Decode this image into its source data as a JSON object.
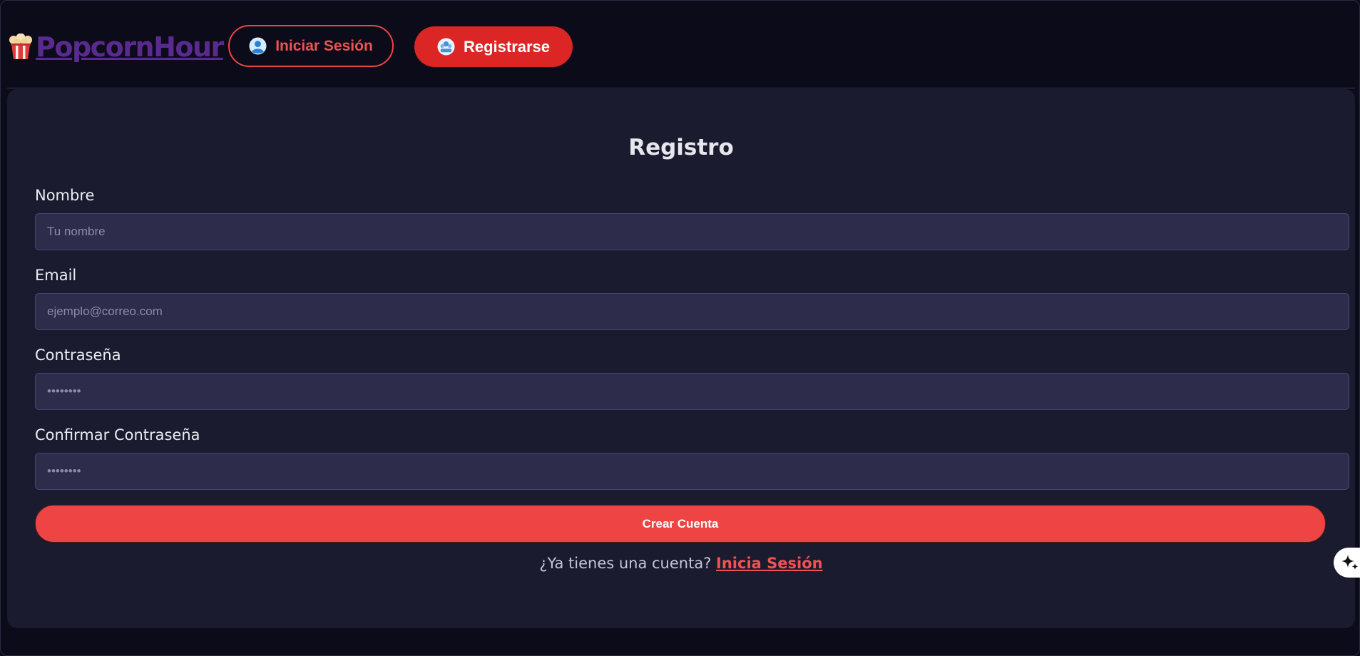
{
  "brand": {
    "name": "PopcornHour",
    "logo_icon": "popcorn-bucket-icon"
  },
  "header": {
    "login_button": {
      "label": "Iniciar Sesión",
      "icon": "user-icon"
    },
    "register_button": {
      "label": "Registrarse",
      "icon": "user-group-icon"
    }
  },
  "form": {
    "title": "Registro",
    "fields": [
      {
        "label": "Nombre",
        "placeholder": "Tu nombre",
        "type": "text"
      },
      {
        "label": "Email",
        "placeholder": "ejemplo@correo.com",
        "type": "email"
      },
      {
        "label": "Contraseña",
        "placeholder": "••••••••",
        "type": "password"
      },
      {
        "label": "Confirmar Contraseña",
        "placeholder": "••••••••",
        "type": "password"
      }
    ],
    "submit_label": "Crear Cuenta",
    "login_prompt": "¿Ya tienes una cuenta?",
    "login_link": "Inicia Sesión"
  },
  "colors": {
    "background": "#0b0b1a",
    "card": "#1b1b2f",
    "input": "#2d2d4b",
    "accent_red": "#ef4444",
    "brand_purple": "#5b2a8e"
  },
  "floating_helper": {
    "icon": "sparkle-icon"
  }
}
